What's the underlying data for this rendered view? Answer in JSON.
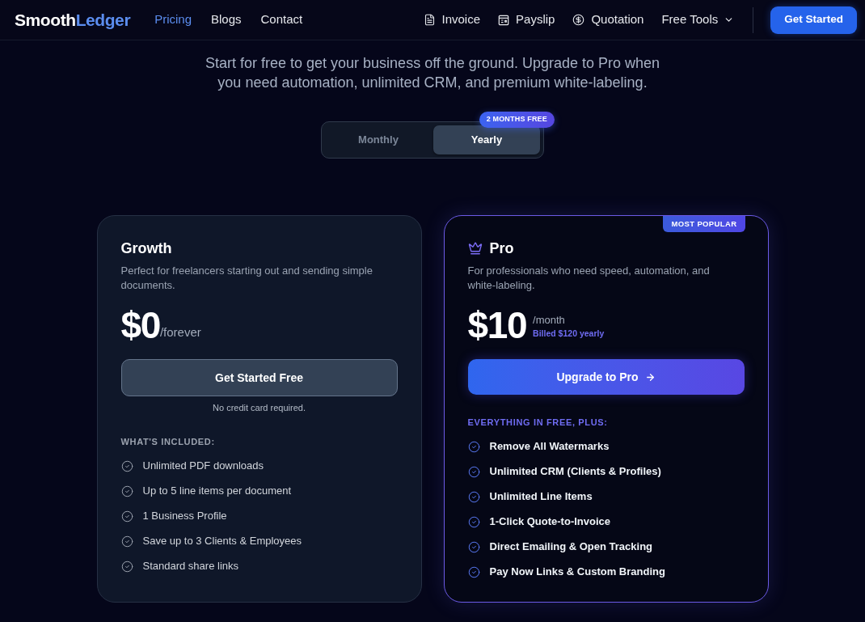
{
  "nav": {
    "logo": {
      "text": "Smooth",
      "accent": "Ledger"
    },
    "links": [
      {
        "label": "Pricing",
        "selected": true
      },
      {
        "label": "Blogs",
        "selected": false
      },
      {
        "label": "Contact",
        "selected": false
      }
    ],
    "tools": [
      {
        "label": "Invoice"
      },
      {
        "label": "Payslip"
      },
      {
        "label": "Quotation"
      }
    ],
    "menu": {
      "label": "Free Tools",
      "expanded": false
    },
    "cta": "Get Started"
  },
  "intro": "Start for free to get your business off the ground. Upgrade to Pro when you need automation, unlimited CRM, and premium white-labeling.",
  "billing": {
    "options": [
      {
        "label": "Monthly",
        "selected": false
      },
      {
        "label": "Yearly",
        "selected": true
      }
    ],
    "badge": "2 MONTHS FREE"
  },
  "plans": [
    {
      "kind": "standard",
      "name": "Growth",
      "description": "Perfect for freelancers starting out and sending simple documents.",
      "price": "$0",
      "period": "/forever",
      "button": "Get Started Free",
      "note": "No credit card required.",
      "features_heading": "WHAT'S INCLUDED:",
      "features": [
        "Unlimited PDF downloads",
        "Up to 5 line items per document",
        "1 Business Profile",
        "Save up to 3 Clients & Employees",
        "Standard share links"
      ]
    },
    {
      "kind": "featured",
      "badge": "MOST POPULAR",
      "name": "Pro",
      "description": "For professionals who need speed, automation, and white-labeling.",
      "price": "$10",
      "period": "/month",
      "billing_note": "Billed $120 yearly",
      "button": "Upgrade to Pro",
      "features_heading": "EVERYTHING IN FREE, PLUS:",
      "features": [
        "Remove All Watermarks",
        "Unlimited CRM (Clients & Profiles)",
        "Unlimited Line Items",
        "1-Click Quote-to-Invoice",
        "Direct Emailing & Open Tracking",
        "Pay Now Links & Custom Branding"
      ]
    }
  ]
}
